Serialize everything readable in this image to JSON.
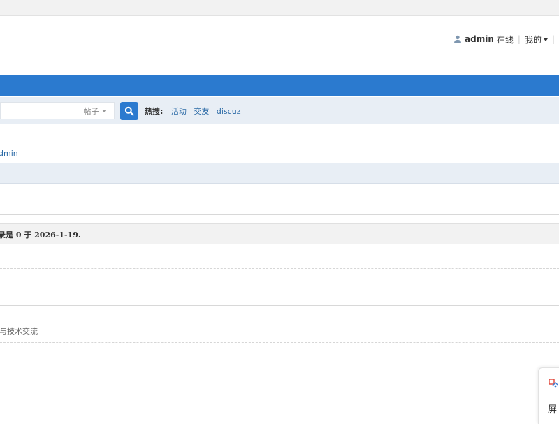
{
  "header": {
    "username": "admin",
    "online_status": "在线",
    "separator": "|",
    "my_menu_label": "我的"
  },
  "search": {
    "input_value": "",
    "type_selected": "帖子",
    "hot_label": "热搜:",
    "hot_keywords": [
      "活动",
      "交友",
      "discuz"
    ]
  },
  "breadcrumb": {
    "fragment": "dmin"
  },
  "notice": {
    "text": "录是 0 于 2026-1-19."
  },
  "forum": {
    "description_fragment": "与技术交流"
  },
  "floating_widget": {
    "label": "屏"
  },
  "colors": {
    "accent": "#2b7acf",
    "link": "#2b6aa6",
    "band": "#e8eef5"
  }
}
